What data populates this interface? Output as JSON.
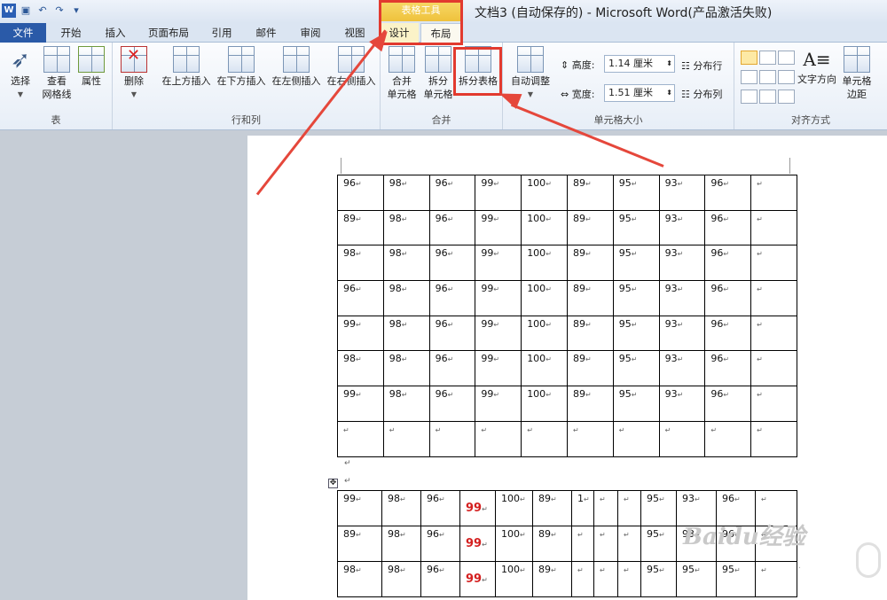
{
  "window": {
    "title": "文档3 (自动保存的) - Microsoft Word(产品激活失败)",
    "context_group": "表格工具"
  },
  "qat": {
    "icons": [
      "word-logo",
      "save-icon",
      "undo-icon",
      "redo-icon",
      "customize-icon"
    ]
  },
  "tabs": {
    "file": "文件",
    "home": "开始",
    "insert": "插入",
    "page_layout": "页面布局",
    "references": "引用",
    "mailings": "邮件",
    "review": "审阅",
    "view": "视图",
    "design": "设计",
    "layout": "布局"
  },
  "ribbon": {
    "table_group": {
      "label": "表",
      "select": "选择",
      "gridlines_1": "查看",
      "gridlines_2": "网格线",
      "properties": "属性"
    },
    "rows_cols_group": {
      "label": "行和列",
      "delete": "删除",
      "insert_above": "在上方插入",
      "insert_below": "在下方插入",
      "insert_left": "在左侧插入",
      "insert_right": "在右侧插入"
    },
    "merge_group": {
      "label": "合并",
      "merge_1": "合并",
      "merge_2": "单元格",
      "split_1": "拆分",
      "split_2": "单元格",
      "split_table": "拆分表格"
    },
    "cell_size_group": {
      "label": "单元格大小",
      "autofit": "自动调整",
      "height_label": "高度:",
      "height_value": "1.14 厘米",
      "width_label": "宽度:",
      "width_value": "1.51 厘米",
      "distribute_rows": "分布行",
      "distribute_cols": "分布列"
    },
    "alignment_group": {
      "label": "对齐方式",
      "text_direction": "文字方向",
      "cell_margins_1": "单元格",
      "cell_margins_2": "边距"
    }
  },
  "document": {
    "mark": "↵",
    "table1": {
      "rows": [
        [
          "96",
          "98",
          "96",
          "99",
          "100",
          "89",
          "95",
          "93",
          "96",
          ""
        ],
        [
          "89",
          "98",
          "96",
          "99",
          "100",
          "89",
          "95",
          "93",
          "96",
          ""
        ],
        [
          "98",
          "98",
          "96",
          "99",
          "100",
          "89",
          "95",
          "93",
          "96",
          ""
        ],
        [
          "96",
          "98",
          "96",
          "99",
          "100",
          "89",
          "95",
          "93",
          "96",
          ""
        ],
        [
          "99",
          "98",
          "96",
          "99",
          "100",
          "89",
          "95",
          "93",
          "96",
          ""
        ],
        [
          "98",
          "98",
          "96",
          "99",
          "100",
          "89",
          "95",
          "93",
          "96",
          ""
        ],
        [
          "99",
          "98",
          "96",
          "99",
          "100",
          "89",
          "95",
          "93",
          "96",
          ""
        ],
        [
          "",
          "",
          "",
          "",
          "",
          "",
          "",
          "",
          "",
          ""
        ]
      ]
    },
    "table2": {
      "rows": [
        [
          "99",
          "98",
          "96",
          "99",
          "100",
          "89",
          "1",
          "",
          "",
          "95",
          "93",
          "96",
          ""
        ],
        [
          "89",
          "98",
          "96",
          "99",
          "100",
          "89",
          "",
          "",
          "",
          "95",
          "93",
          "96",
          ""
        ],
        [
          "98",
          "98",
          "96",
          "99",
          "100",
          "89",
          "",
          "",
          "",
          "95",
          "95",
          "95",
          ""
        ]
      ]
    },
    "watermark": "Baidu经验"
  },
  "colors": {
    "highlight": "#e23a2f",
    "file_tab": "#2a5aa8",
    "context_header": "#efc23c"
  }
}
